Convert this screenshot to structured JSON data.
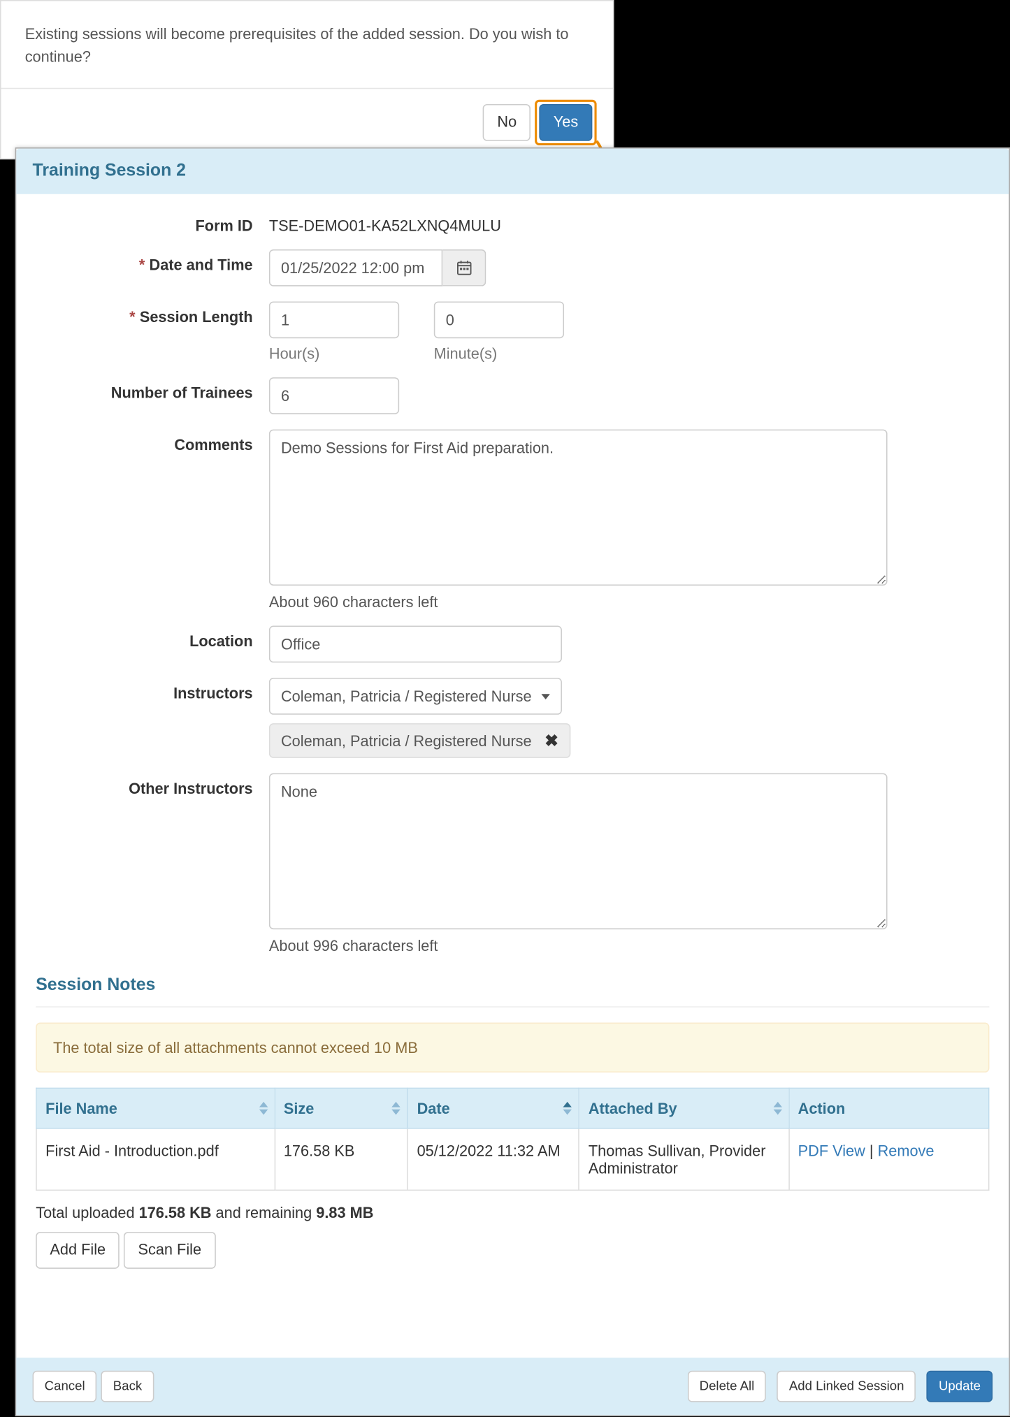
{
  "dialog": {
    "message": "Existing sessions will become prerequisites of the added session. Do you wish to continue?",
    "no_label": "No",
    "yes_label": "Yes"
  },
  "header": {
    "title": "Training Session 2"
  },
  "form": {
    "formid_label": "Form ID",
    "formid_value": "TSE-DEMO01-KA52LXNQ4MULU",
    "datetime_label": "Date and Time",
    "datetime_value": "01/25/2022 12:00 pm",
    "session_len_label": "Session Length",
    "hours_value": "1",
    "minutes_value": "0",
    "hours_sub": "Hour(s)",
    "minutes_sub": "Minute(s)",
    "trainees_label": "Number of Trainees",
    "trainees_value": "6",
    "comments_label": "Comments",
    "comments_value": "Demo Sessions for First Aid preparation.",
    "comments_count": "About 960 characters left",
    "location_label": "Location",
    "location_value": "Office",
    "instructors_label": "Instructors",
    "instructors_selected": "Coleman, Patricia / Registered Nurse",
    "instructors_chip": "Coleman, Patricia / Registered Nurse",
    "other_instructors_label": "Other Instructors",
    "other_instructors_value": "None",
    "other_instructors_count": "About 996 characters left"
  },
  "notes": {
    "title": "Session Notes",
    "warning": "The total size of all attachments cannot exceed 10 MB",
    "cols": {
      "file": "File Name",
      "size": "Size",
      "date": "Date",
      "by": "Attached By",
      "action": "Action"
    },
    "row": {
      "file": "First Aid - Introduction.pdf",
      "size": "176.58 KB",
      "date": "05/12/2022 11:32 AM",
      "by": "Thomas Sullivan, Provider Administrator",
      "pdfview": "PDF View",
      "sep": " | ",
      "remove": "Remove"
    },
    "summary_prefix": "Total uploaded ",
    "summary_size": "176.58 KB",
    "summary_mid": " and remaining ",
    "summary_remain": "9.83 MB",
    "add_file": "Add File",
    "scan_file": "Scan File"
  },
  "footer": {
    "cancel": "Cancel",
    "back": "Back",
    "delete_all": "Delete All",
    "add_linked": "Add Linked Session",
    "update": "Update"
  }
}
